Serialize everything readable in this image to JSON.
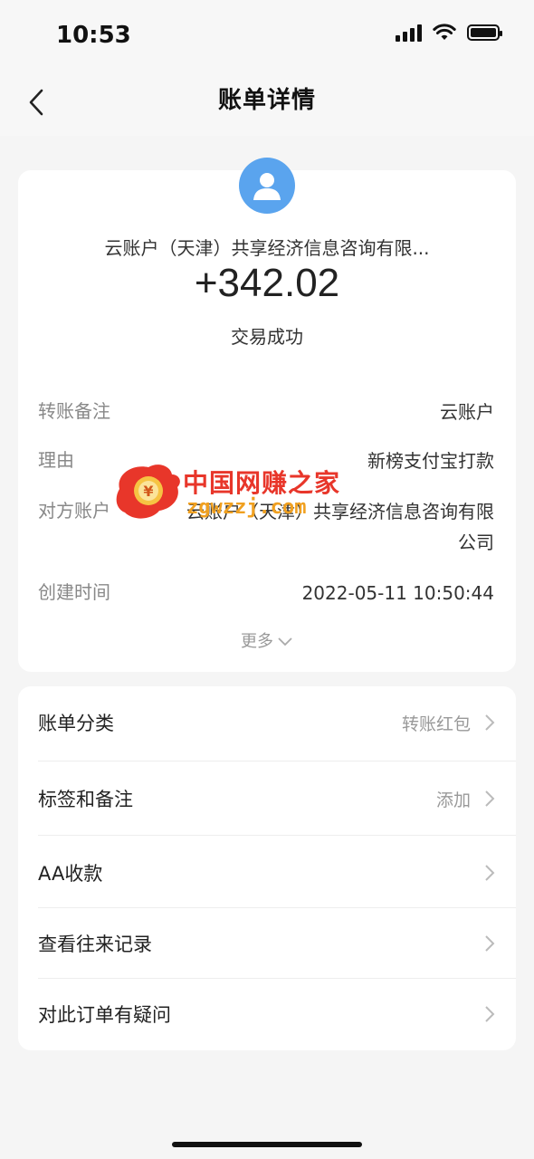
{
  "status_bar": {
    "time": "10:53"
  },
  "nav": {
    "title": "账单详情"
  },
  "summary": {
    "counterparty": "云账户（天津）共享经济信息咨询有限...",
    "amount": "+342.02",
    "status": "交易成功"
  },
  "details": [
    {
      "label": "转账备注",
      "value": "云账户"
    },
    {
      "label": "理由",
      "value": "新榜支付宝打款"
    },
    {
      "label": "对方账户",
      "value_line1": "云账户（天津）共享经济信息咨询有限",
      "value_line2": "公司"
    },
    {
      "label": "创建时间",
      "value": "2022-05-11 10:50:44"
    }
  ],
  "more_label": "更多",
  "watermark": {
    "text": "中国网赚之家",
    "url": "zgwzzj.com"
  },
  "menu": [
    {
      "label": "账单分类",
      "value": "转账红包"
    },
    {
      "label": "标签和备注",
      "value": "添加"
    },
    {
      "label": "AA收款",
      "value": ""
    },
    {
      "label": "查看往来记录",
      "value": ""
    },
    {
      "label": "对此订单有疑问",
      "value": ""
    }
  ],
  "colors": {
    "avatar": "#5aa4ee",
    "watermark_red": "#e8362a",
    "watermark_orange": "#f0a020"
  }
}
